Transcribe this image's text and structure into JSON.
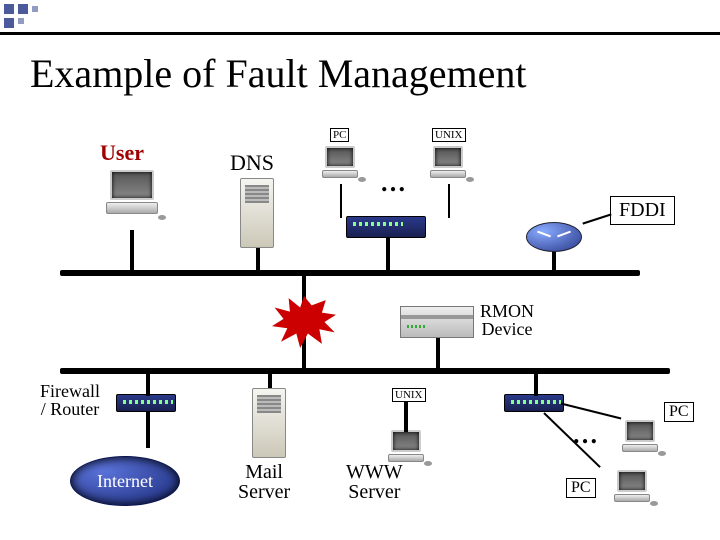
{
  "corner": {
    "present": true
  },
  "title": "Example of Fault Management",
  "labels": {
    "user": "User",
    "dns": "DNS",
    "pc_tag_top": "PC",
    "unix_tag_top": "UNIX",
    "ellipsis_top": "…",
    "fddi": "FDDI",
    "rmon": "RMON\nDevice",
    "firewall": "Firewall\n/ Router",
    "unix_tag_bottom": "UNIX",
    "mail": "Mail\nServer",
    "www": "WWW\nServer",
    "internet": "Internet",
    "ellipsis_bottom": "…",
    "pc_tag_br": "PC",
    "pc_tag_br2": "PC"
  }
}
